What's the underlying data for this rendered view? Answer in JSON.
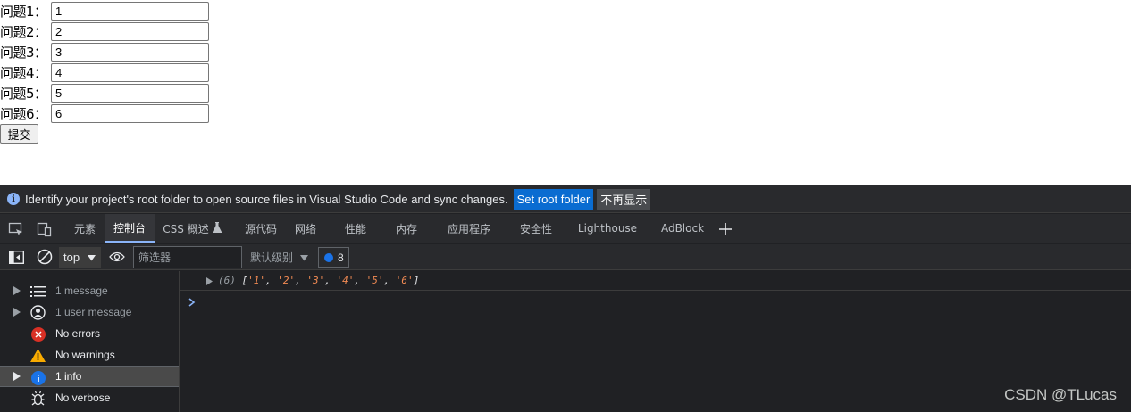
{
  "form": {
    "questions": [
      {
        "label": "问题1：",
        "value": "1"
      },
      {
        "label": "问题2：",
        "value": "2"
      },
      {
        "label": "问题3：",
        "value": "3"
      },
      {
        "label": "问题4：",
        "value": "4"
      },
      {
        "label": "问题5：",
        "value": "5"
      },
      {
        "label": "问题6：",
        "value": "6"
      }
    ],
    "submit_label": "提交"
  },
  "devtools": {
    "infobar": {
      "message": "Identify your project's root folder to open source files in Visual Studio Code and sync changes.",
      "set_root_label": "Set root folder",
      "dismiss_label": "不再显示"
    },
    "tabs": [
      "元素",
      "控制台",
      "CSS 概述",
      "源代码",
      "网络",
      "性能",
      "内存",
      "应用程序",
      "安全性",
      "Lighthouse",
      "AdBlock"
    ],
    "active_tab": "控制台",
    "toolbar": {
      "context": "top",
      "filter_placeholder": "筛选器",
      "level": "默认级别",
      "issue_count": "8"
    },
    "sidebar": [
      {
        "label": "1 message",
        "icon": "list-icon"
      },
      {
        "label": "1 user message",
        "icon": "user-icon"
      },
      {
        "label": "No errors",
        "icon": "error-icon"
      },
      {
        "label": "No warnings",
        "icon": "warning-icon"
      },
      {
        "label": "1 info",
        "icon": "info-icon"
      },
      {
        "label": "No verbose",
        "icon": "bug-icon"
      }
    ],
    "console": {
      "count": "(6)",
      "entries": [
        "'1'",
        "'2'",
        "'3'",
        "'4'",
        "'5'",
        "'6'"
      ]
    }
  },
  "watermark": "CSDN @TLucas",
  "colors": {
    "devtools_bg": "#202124",
    "accent_blue": "#0a6cd1",
    "active_tab_underline": "#8ab4f8",
    "error_red": "#d93025",
    "warning_yellow": "#f9ab00",
    "info_blue": "#1a73e8"
  }
}
